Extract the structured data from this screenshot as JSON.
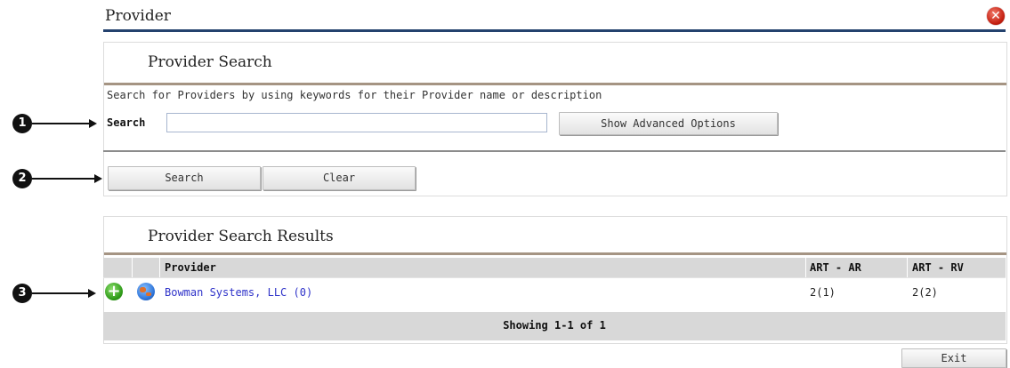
{
  "window": {
    "title": "Provider"
  },
  "search_panel": {
    "title": "Provider Search",
    "description": "Search for Providers by using keywords for their Provider name or description",
    "search_label": "Search",
    "search_value": "",
    "advanced_button": "Show Advanced Options",
    "search_button": "Search",
    "clear_button": "Clear"
  },
  "results_panel": {
    "title": "Provider Search Results",
    "columns": [
      "Provider",
      "ART - AR",
      "ART - RV"
    ],
    "rows": [
      {
        "provider": "Bowman Systems, LLC (0)",
        "art_ar": "2(1)",
        "art_rv": "2(2)"
      }
    ],
    "footer": "Showing 1-1 of 1"
  },
  "exit_button": "Exit",
  "callouts": [
    "1",
    "2",
    "3"
  ],
  "icons": {
    "close": "close-icon",
    "add": "add-icon",
    "provider": "globe-icon"
  }
}
